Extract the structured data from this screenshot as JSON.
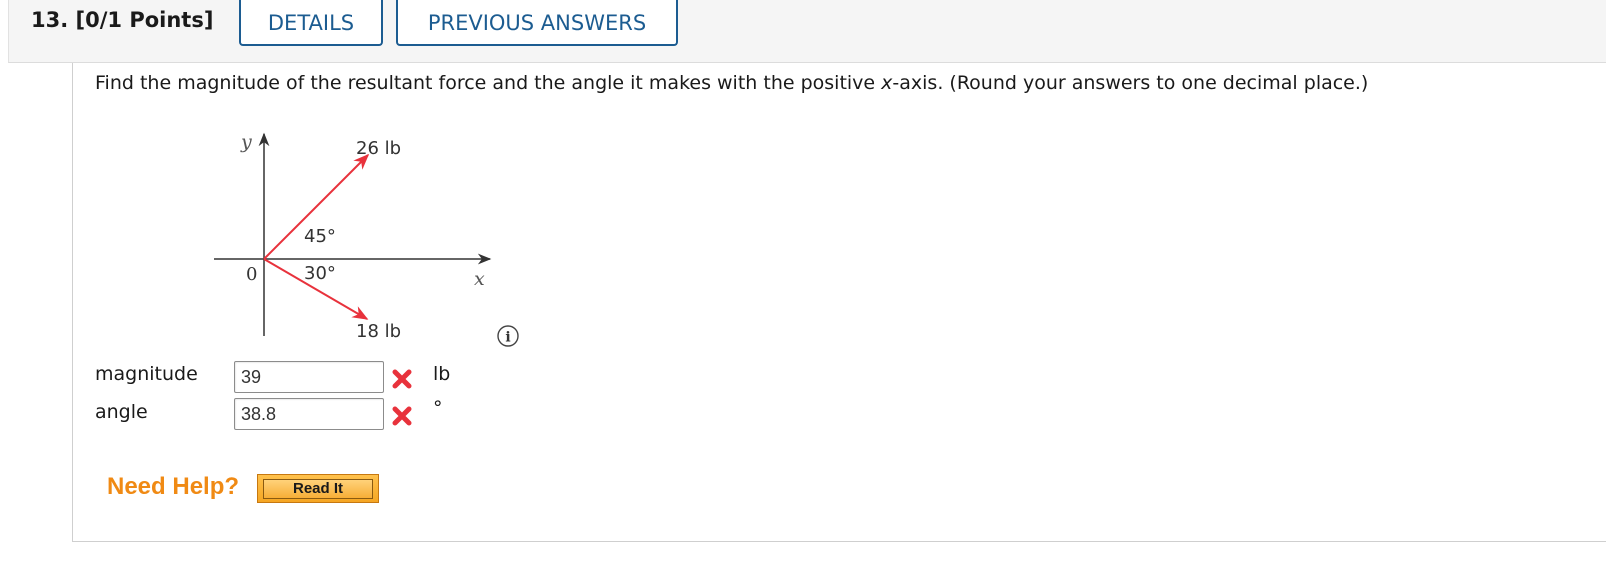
{
  "header": {
    "question_number": "13.",
    "points": "[0/1 Points]",
    "details_label": "DETAILS",
    "previous_answers_label": "PREVIOUS ANSWERS"
  },
  "question": {
    "text_before": "Find the magnitude of the resultant force and the angle it makes with the positive ",
    "var": "x",
    "text_after": "-axis. (Round your answers to one decimal place.)"
  },
  "diagram": {
    "y_label": "y",
    "x_label": "x",
    "origin_label": "0",
    "force_up_label": "26 lb",
    "force_down_label": "18 lb",
    "angle_up_label": "45°",
    "angle_down_label": "30°",
    "arrow_color": "#e8323c"
  },
  "answers": {
    "magnitude": {
      "label": "magnitude",
      "value": "39",
      "unit": "lb",
      "status": "incorrect"
    },
    "angle": {
      "label": "angle",
      "value": "38.8",
      "unit": "°",
      "status": "incorrect"
    }
  },
  "help": {
    "need_help_label": "Need Help?",
    "read_it_label": "Read It"
  },
  "colors": {
    "tab_blue": "#1c5c91",
    "incorrect_red": "#e8323c",
    "help_orange": "#f08a14"
  }
}
